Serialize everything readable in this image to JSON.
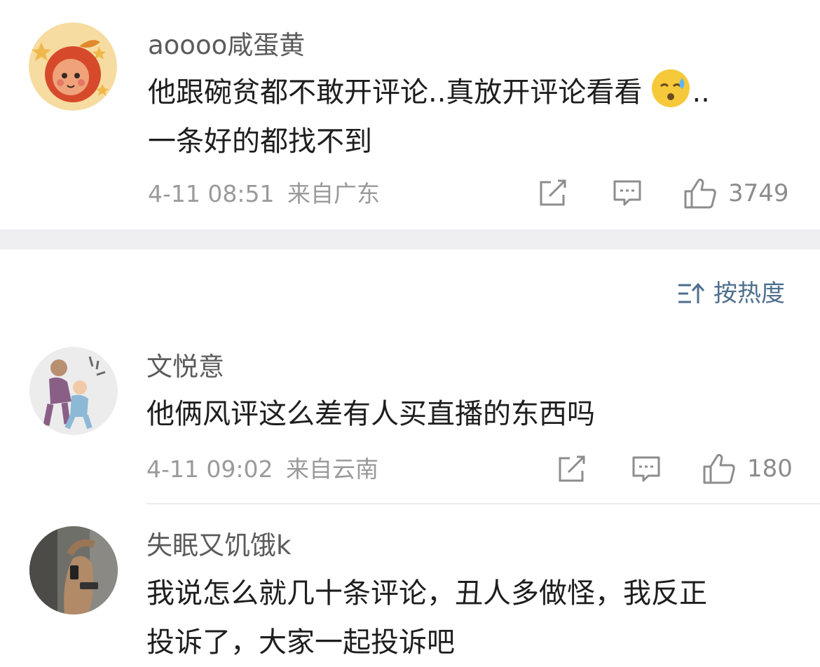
{
  "comments": [
    {
      "username": "aoooo咸蛋黄",
      "text_line1": "他跟碗贫都不敢开评论..真放开评论看看",
      "emoji": "sweat-smile-emoji",
      "text_line1_tail": "..",
      "text_line2": "一条好的都找不到",
      "timestamp": "4-11 08:51",
      "location": "来自广东",
      "likes": "3749"
    },
    {
      "username": "文悦意",
      "text_line1": "他俩风评这么差有人买直播的东西吗",
      "timestamp": "4-11 09:02",
      "location": "来自云南",
      "likes": "180"
    },
    {
      "username": "失眠又饥饿k",
      "text_line1": "我说怎么就几十条评论，丑人多做怪，我反正",
      "text_line2": "投诉了，大家一起投诉吧"
    }
  ],
  "sort": {
    "label": "按热度",
    "icon": "sort-icon"
  },
  "icons": {
    "share": "share-icon",
    "comment": "comment-icon",
    "like": "thumbs-up-icon"
  },
  "colors": {
    "username": "#5b5b5b",
    "text": "#1e1e1e",
    "meta": "#9a9a9a",
    "sort": "#4e6f8e",
    "separator": "#efeff1"
  }
}
